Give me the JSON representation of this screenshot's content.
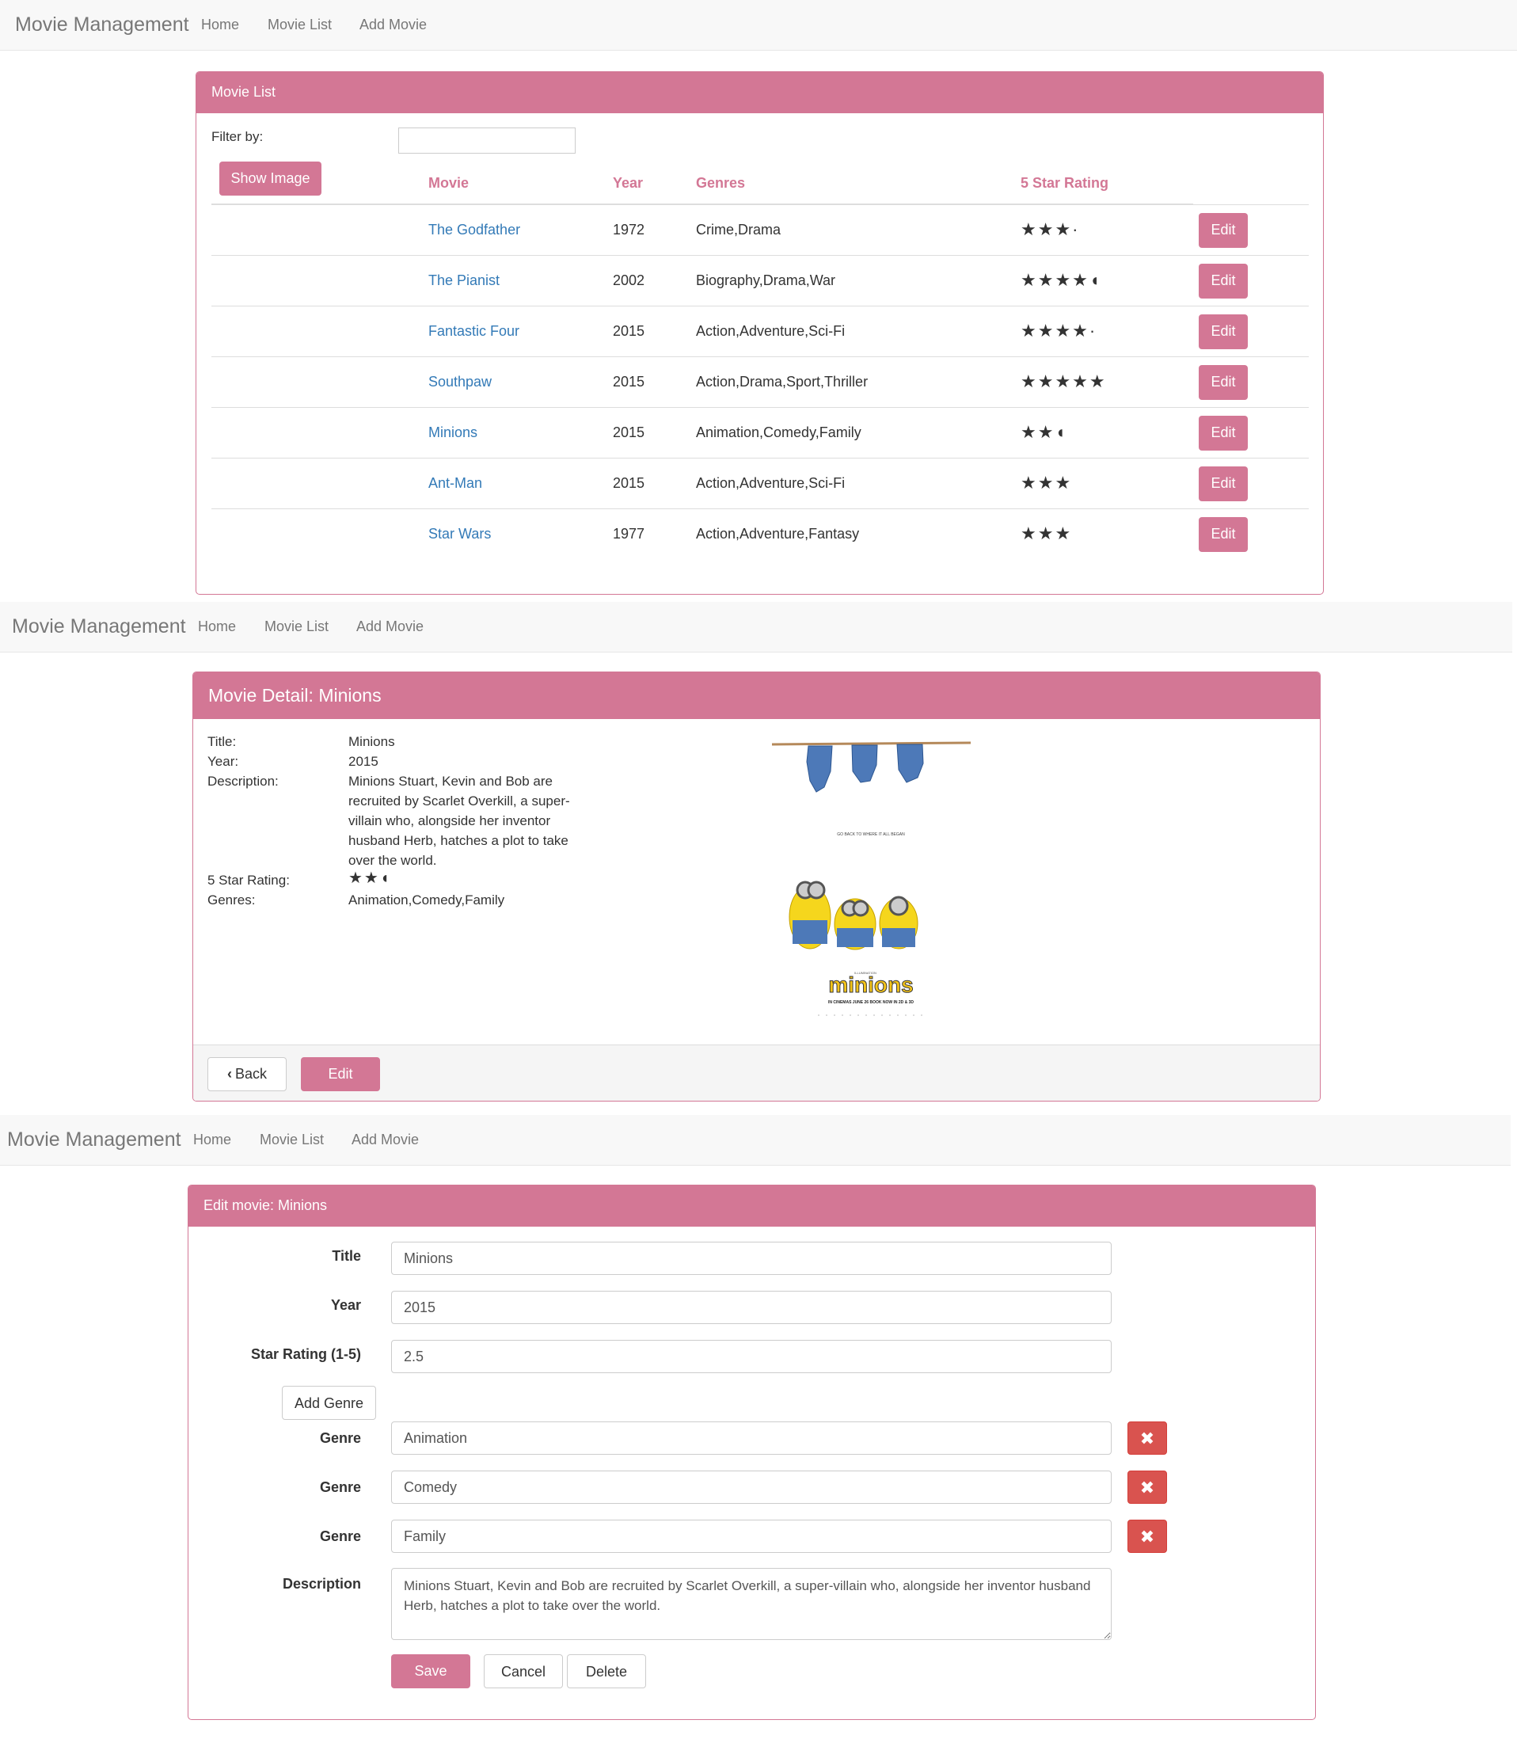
{
  "navbar": {
    "brand": "Movie Management",
    "links": [
      "Home",
      "Movie List",
      "Add Movie"
    ]
  },
  "movie_list": {
    "panel_title": "Movie List",
    "filter_label": "Filter by:",
    "filter_value": "",
    "show_image_label": "Show Image",
    "columns": [
      "Movie",
      "Year",
      "Genres",
      "5 Star Rating"
    ],
    "edit_label": "Edit",
    "rows": [
      {
        "movie": "The Godfather",
        "year": "1972",
        "genres": "Crime,Drama",
        "stars": "★★★·",
        "rating": 3.1
      },
      {
        "movie": "The Pianist",
        "year": "2002",
        "genres": "Biography,Drama,War",
        "stars": "★★★★◖",
        "rating": 4.2
      },
      {
        "movie": "Fantastic Four",
        "year": "2015",
        "genres": "Action,Adventure,Sci-Fi",
        "stars": "★★★★·",
        "rating": 4.1
      },
      {
        "movie": "Southpaw",
        "year": "2015",
        "genres": "Action,Drama,Sport,Thriller",
        "stars": "★★★★★",
        "rating": 5
      },
      {
        "movie": "Minions",
        "year": "2015",
        "genres": "Animation,Comedy,Family",
        "stars": "★★◖",
        "rating": 2.5
      },
      {
        "movie": "Ant-Man",
        "year": "2015",
        "genres": "Action,Adventure,Sci-Fi",
        "stars": "★★★",
        "rating": 3
      },
      {
        "movie": "Star Wars",
        "year": "1977",
        "genres": "Action,Adventure,Fantasy",
        "stars": "★★★",
        "rating": 3
      }
    ]
  },
  "movie_detail": {
    "panel_title": "Movie Detail: Minions",
    "labels": {
      "title": "Title:",
      "year": "Year:",
      "description": "Description:",
      "rating": "5 Star Rating:",
      "genres": "Genres:"
    },
    "title": "Minions",
    "year": "2015",
    "description_lines": [
      "Minions Stuart, Kevin and Bob are",
      "recruited by Scarlet Overkill, a super-",
      "villain who, alongside her inventor",
      "husband Herb, hatches a plot to take",
      "over the world."
    ],
    "stars": "★★◖",
    "rating": 2.5,
    "genres": "Animation,Comedy,Family",
    "poster": {
      "tagline": "GO BACK TO WHERE IT ALL BEGAN",
      "studio": "ILLUMINATION",
      "logo": "minions",
      "release": "IN CINEMAS JUNE 26 BOOK NOW IN 2D & 3D"
    },
    "back_label": "Back",
    "edit_label": "Edit"
  },
  "edit_movie": {
    "panel_title": "Edit movie: Minions",
    "title_label": "Title",
    "title_value": "Minions",
    "year_label": "Year",
    "year_value": "2015",
    "rating_label": "Star Rating (1-5)",
    "rating_value": "2.5",
    "add_genre_label": "Add Genre",
    "genre_label": "Genre",
    "genres": [
      "Animation",
      "Comedy",
      "Family"
    ],
    "description_label": "Description",
    "description_value": "Minions Stuart, Kevin and Bob are recruited by Scarlet Overkill, a super-villain who, alongside her inventor husband Herb, hatches a plot to take over the world.",
    "save_label": "Save",
    "cancel_label": "Cancel",
    "delete_label": "Delete"
  },
  "colors": {
    "accent": "#d37795",
    "link": "#337ab7",
    "danger": "#d9534f",
    "navbar_bg": "#f8f8f8"
  }
}
